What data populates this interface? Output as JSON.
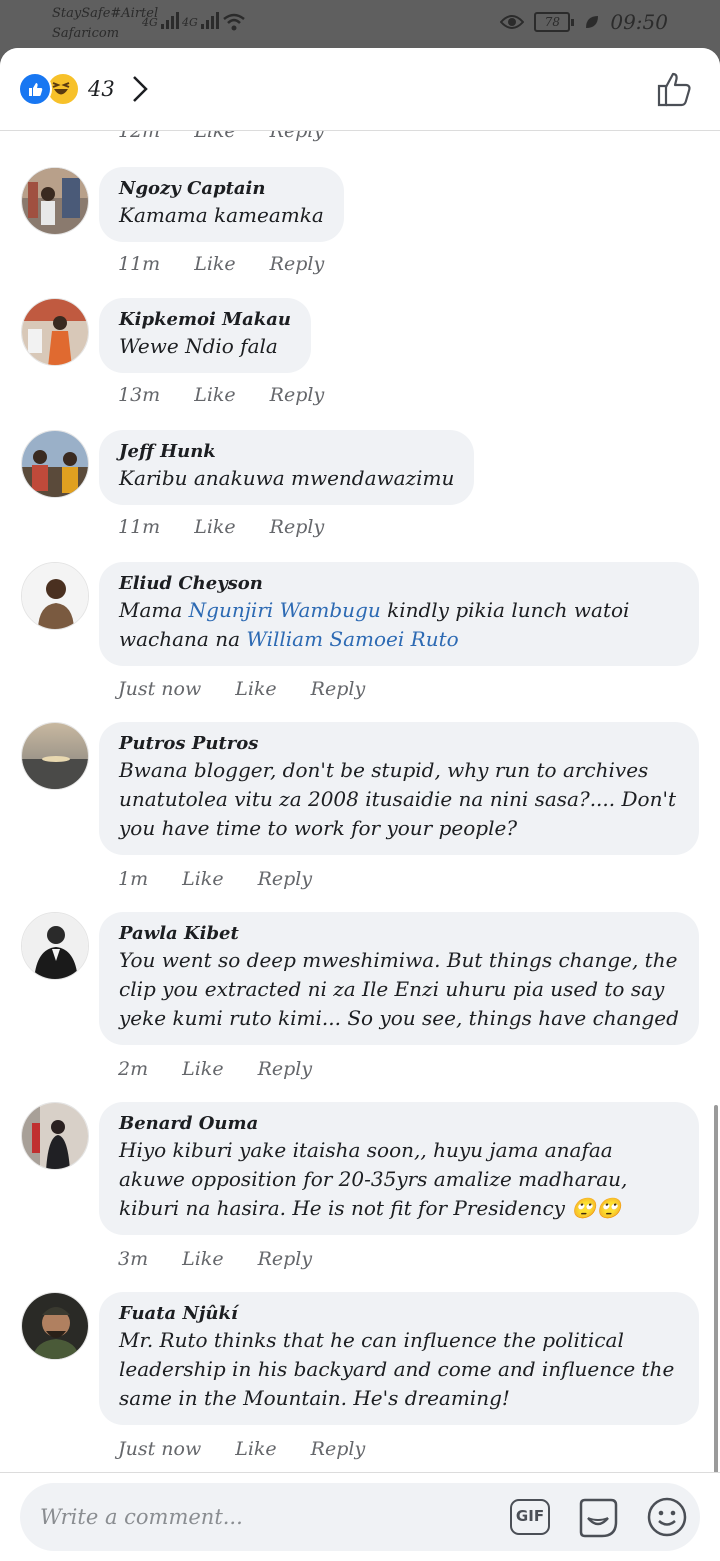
{
  "status_bar": {
    "carrier_line1": "StaySafe#Airtel",
    "carrier_line2": "Safaricom",
    "network1": "4G",
    "network2": "4G",
    "battery": "78",
    "time": "09:50"
  },
  "header": {
    "reaction_count": "43"
  },
  "top_partial_meta": {
    "time": "12m",
    "like": "Like",
    "reply": "Reply"
  },
  "comments": [
    {
      "name": "Ngozy Captain",
      "text": "Kamama kameamka",
      "time": "11m",
      "like": "Like",
      "reply": "Reply"
    },
    {
      "name": "Kipkemoi Makau",
      "text": "Wewe Ndio fala",
      "time": "13m",
      "like": "Like",
      "reply": "Reply"
    },
    {
      "name": "Jeff Hunk",
      "text": "Karibu anakuwa mwendawazimu",
      "time": "11m",
      "like": "Like",
      "reply": "Reply"
    },
    {
      "name": "Eliud Cheyson",
      "text_pre": "Mama ",
      "tag1": "Ngunjiri Wambugu",
      "text_mid": " kindly pikia lunch watoi wachana na ",
      "tag2": "William Samoei Ruto",
      "time": "Just now",
      "like": "Like",
      "reply": "Reply"
    },
    {
      "name": "Putros Putros",
      "text": "Bwana blogger, don't be stupid, why run to archives unatutolea vitu za 2008 itusaidie na nini sasa?.... Don't you have time to work for your people?",
      "time": "1m",
      "like": "Like",
      "reply": "Reply"
    },
    {
      "name": "Pawla Kibet",
      "text": "You went so deep mweshimiwa. But things change, the clip you extracted ni za Ile Enzi uhuru pia used to say yeke kumi ruto kimi... So you see, things have changed",
      "time": "2m",
      "like": "Like",
      "reply": "Reply"
    },
    {
      "name": "Benard Ouma",
      "text": "Hiyo kiburi yake itaisha soon,, huyu jama anafaa akuwe opposition for 20-35yrs amalize madharau, kiburi na hasira. He is not fit for Presidency 🙄🙄",
      "time": "3m",
      "like": "Like",
      "reply": "Reply"
    },
    {
      "name": "Fuata Njûkí",
      "text": "Mr. Ruto thinks that he can influence the political leadership in his backyard and come and influence the same in the Mountain. He's dreaming!",
      "time": "Just now",
      "like": "Like",
      "reply": "Reply"
    }
  ],
  "composer": {
    "placeholder": "Write a comment...",
    "gif_label": "GIF"
  },
  "icons": [
    "like-reaction-icon",
    "haha-reaction-icon",
    "chevron-right-icon",
    "thumbs-up-icon",
    "sticker-icon",
    "emoji-icon",
    "eye-icon",
    "leaf-icon",
    "wifi-icon"
  ],
  "colors": {
    "link": "#2d6ab3",
    "like_blue": "#1877f2",
    "bubble": "#f0f2f5"
  }
}
